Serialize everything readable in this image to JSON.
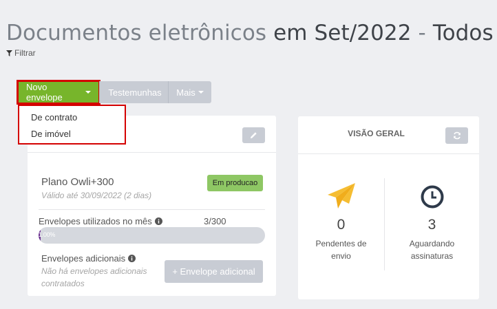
{
  "header": {
    "title_part1": "Documentos eletrônicos",
    "title_part2": "em Set/2022",
    "title_sep": "-",
    "title_part3": "Todos",
    "filter_label": "Filtrar"
  },
  "toolbar": {
    "new_envelope": "Novo envelope",
    "witnesses": "Testemunhas",
    "more": "Mais"
  },
  "dropdown": {
    "items": [
      "De contrato",
      "De imóvel"
    ]
  },
  "plan": {
    "name": "Plano Owli+300",
    "valid_until": "Válido até 30/09/2022 (2 dias)",
    "status": "Em producao",
    "usage_label": "Envelopes utilizados no mês",
    "usage_count": "3/300",
    "usage_percent_text": "1.00%",
    "usage_fraction": 0.01,
    "extra_label": "Envelopes adicionais",
    "extra_note": "Não há envelopes adicionais contratados",
    "add_button": "+ Envelope adicional"
  },
  "overview": {
    "title": "VISÃO GERAL",
    "pending_count": "0",
    "pending_label": "Pendentes de envio",
    "awaiting_count": "3",
    "awaiting_label": "Aguardando assinaturas"
  },
  "colors": {
    "accent_green": "#77b52b",
    "badge_green": "#8ec764",
    "progress_purple": "#6a2f8f",
    "plane_yellow": "#f5bd32",
    "clock_navy": "#2e3a4a",
    "highlight_red": "#d40000"
  },
  "icons": {
    "filter": "funnel-icon",
    "user": "user-icon",
    "edit": "pencil-icon",
    "refresh": "refresh-icon",
    "info": "info-circle-icon",
    "pending": "paper-plane-icon",
    "awaiting": "clock-icon"
  }
}
